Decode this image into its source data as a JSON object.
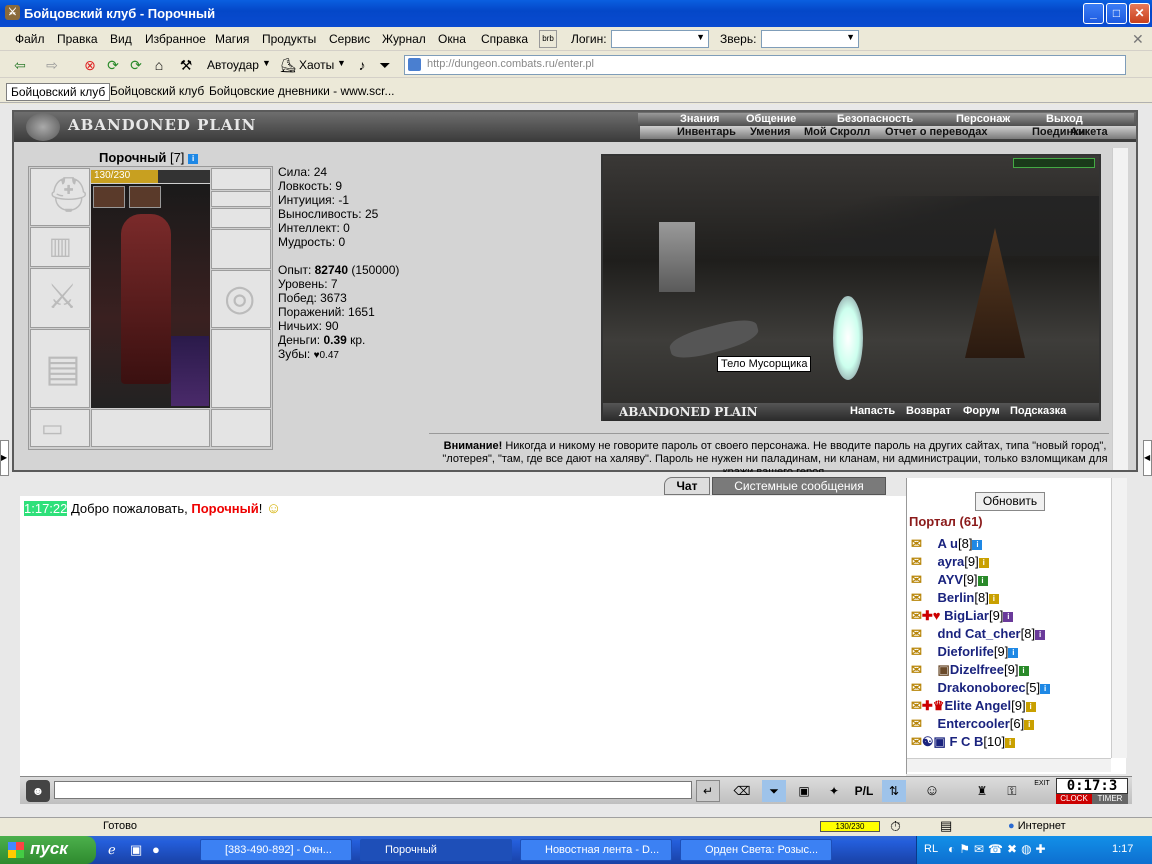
{
  "window": {
    "title": "Бойцовский клуб - Порочный",
    "minimize": "_",
    "maximize": "□",
    "close": "✕"
  },
  "menu": [
    "Файл",
    "Правка",
    "Вид",
    "Избранное",
    "Магия",
    "Продукты",
    "Сервис",
    "Журнал",
    "Окна",
    "Справка"
  ],
  "login_label": "Логин:",
  "beast_label": "Зверь:",
  "toolbar": {
    "autostrike": "Автоудар",
    "chaos": "Хаоты"
  },
  "address": "http://dungeon.combats.ru/enter.pl",
  "links": [
    "Бойцовский клуб",
    "Бойцовский клуб",
    "Бойцовские дневники - www.scr..."
  ],
  "game": {
    "location": "ABANDONED PLAIN",
    "nav_top": [
      "Знания",
      "Общение",
      "Безопасность",
      "Персонаж",
      "Выход"
    ],
    "nav_bottom": [
      "Инвентарь",
      "Умения",
      "Мой Скролл",
      "Отчет о переводах",
      "Поединки",
      "Анкета"
    ],
    "player": {
      "name": "Порочный",
      "level": "[7]",
      "hp": "130/230",
      "hp_fraction": 0.565
    },
    "stats": [
      "Сила: 24",
      "Ловкость: 9",
      "Интуиция: -1",
      "Выносливость: 25",
      "Интеллект: 0",
      "Мудрость: 0"
    ],
    "exp_label": "Опыт: ",
    "exp_value": "82740",
    "exp_next": " (150000)",
    "info": [
      "Уровень: 7",
      "Побед: 3673",
      "Поражений: 1651",
      "Ничьих: 90"
    ],
    "money_label": "Деньги: ",
    "money_value": "0.39",
    "money_unit": " кр.",
    "teeth_label": "Зубы: ",
    "teeth_value": "0.47",
    "scene_tooltip": "Тело Мусорщика",
    "scene_caption": "ABANDONED PLAIN",
    "scene_actions": [
      "Напасть",
      "Возврат",
      "Форум",
      "Подсказка"
    ],
    "warning_bold": "Внимание!",
    "warning_text": " Никогда и никому не говорите пароль от своего персонажа. Не вводите пароль на других сайтах, типа \"новый город\", \"лотерея\", \"там, где все дают на халяву\". Пароль не нужен ни паладинам, ни кланам, ни администрации, только взломщикам для кражи вашего героя.",
    "tabs": [
      "Чат",
      "Системные сообщения"
    ],
    "chat": {
      "time": "1:17:22",
      "text": " Добро пожаловать, ",
      "name": "Порочный",
      "end": "!"
    },
    "refresh": "Обновить",
    "room": "Портал (61)",
    "users": [
      {
        "name": "A u",
        "level": "[8]"
      },
      {
        "name": "ayra",
        "level": "[9]"
      },
      {
        "name": "AYV",
        "level": "[9]"
      },
      {
        "name": "Berlin",
        "level": "[8]"
      },
      {
        "name": "BigLiar",
        "level": "[9]"
      },
      {
        "name": "dnd Cat_cher",
        "level": "[8]"
      },
      {
        "name": "Dieforlife",
        "level": "[9]"
      },
      {
        "name": "Dizelfree",
        "level": "[9]"
      },
      {
        "name": "Drakonoborec",
        "level": "[5]"
      },
      {
        "name": "Elite Angel",
        "level": "[9]"
      },
      {
        "name": "Entercooler",
        "level": "[6]"
      },
      {
        "name": "F C B",
        "level": "[10]"
      }
    ],
    "clock": "0:17:3",
    "clock_labels": [
      "CLOCK",
      "TIMER"
    ]
  },
  "status": {
    "text": "Готово",
    "hp": "130/230",
    "zone": "Интернет"
  },
  "taskbar": {
    "start": "пуск",
    "tasks": [
      "[383-490-892] - Окн...",
      "Порочный",
      "Новостная лента - D...",
      "Орден Света: Розыс..."
    ],
    "lang": "RL",
    "time": "1:17"
  }
}
